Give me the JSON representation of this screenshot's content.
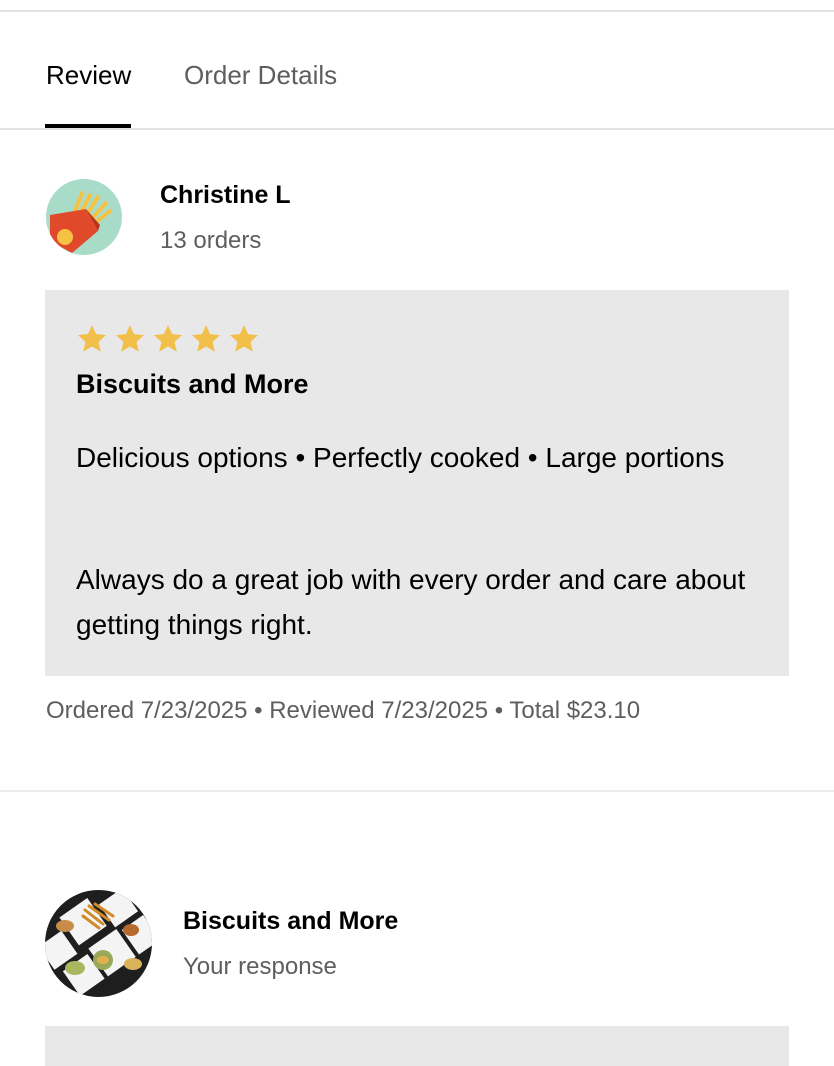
{
  "tabs": [
    {
      "label": "Review",
      "active": true
    },
    {
      "label": "Order Details",
      "active": false
    }
  ],
  "reviewer": {
    "name": "Christine L",
    "orders": "13 orders",
    "avatar_icon": "fries-icon"
  },
  "review": {
    "rating": 5,
    "max_rating": 5,
    "star_color": "#f2bf4a",
    "store": "Biscuits and More",
    "tags": "Delicious options • Perfectly cooked • Large portions",
    "comment": "Always do a great job with every order and care about getting things right."
  },
  "meta": "Ordered 7/23/2025 • Reviewed 7/23/2025 • Total $23.10",
  "response": {
    "store": "Biscuits and More",
    "label": "Your response",
    "avatar_icon": "food-platter-icon"
  }
}
